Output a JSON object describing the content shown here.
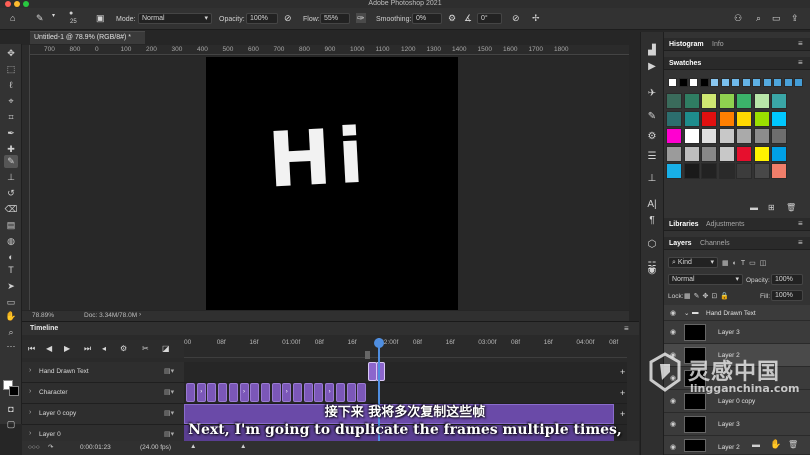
{
  "app": {
    "title": "Adobe Photoshop 2021"
  },
  "options_bar": {
    "brush_size": "25",
    "mode_label": "Mode:",
    "mode_value": "Normal",
    "opacity_label": "Opacity:",
    "opacity_value": "100%",
    "flow_label": "Flow:",
    "flow_value": "55%",
    "smoothing_label": "Smoothing:",
    "smoothing_value": "0%",
    "angle_value": "0°"
  },
  "document": {
    "tab_title": "Untitled-1 @ 78.9% (RGB/8#) *",
    "canvas_text": "Hi",
    "zoom": "78.89%",
    "doc_size": "Doc: 3.34M/78.0M"
  },
  "ruler": [
    "700",
    "800",
    "0",
    "100",
    "200",
    "300",
    "400",
    "500",
    "600",
    "700",
    "800",
    "900",
    "1000",
    "1100",
    "1200",
    "1300",
    "1400",
    "1500",
    "1600",
    "1700",
    "1800"
  ],
  "timeline": {
    "title": "Timeline",
    "timecodes": [
      "00",
      "08f",
      "16f",
      "01:00f",
      "08f",
      "16f",
      "02:00f",
      "08f",
      "16f",
      "03:00f",
      "08f",
      "16f",
      "04:00f",
      "08f",
      "16f",
      "0"
    ],
    "tracks": [
      "Hand Drawn Text",
      "Character",
      "Layer 0 copy",
      "Layer 0"
    ],
    "current_time": "0:00:01:23",
    "fps": "(24.00 fps)"
  },
  "right_panel": {
    "tabs_top": [
      "Histogram",
      "Info"
    ],
    "swatches_tab": "Swatches",
    "swatch_colors": [
      "#3a6b5b",
      "#2f7d62",
      "#cfe872",
      "#8fd14f",
      "#3bb36a",
      "#b8e6a8",
      "#3aa6a6",
      "#2c6e6e",
      "#1e8c8c",
      "#e01010",
      "#ff7f00",
      "#ffd800",
      "#9be000",
      "#00c8ff",
      "#ff00d0",
      "#ffffff",
      "#e0e0e0",
      "#c8c8c8",
      "#aaaaaa",
      "#8c8c8c",
      "#6e6e6e",
      "#9b9b9b",
      "#bdbdbd",
      "#888888",
      "#c8c8c8",
      "#e60f2d",
      "#fff200",
      "#00a0e6",
      "#18b0e8",
      "#1a1a1a",
      "#222222",
      "#2a2a2a",
      "#3c3c3c",
      "#484848",
      "#f07e6a"
    ],
    "swatch_row0": [
      "#ffffff",
      "#000000",
      "#ffffff",
      "#000000",
      "#8ac7f0",
      "#79c0ee",
      "#6fb9ea",
      "#65b3e6",
      "#5eb0e4",
      "#55aadf",
      "#4ea5dc",
      "#4aa1d9",
      "#449dd6"
    ],
    "libraries_tabs": [
      "Libraries",
      "Adjustments"
    ],
    "layers_tabs": [
      "Layers",
      "Channels"
    ],
    "kind_label": "Kind",
    "blend_mode": "Normal",
    "opacity_label": "Opacity:",
    "opacity_value": "100%",
    "lock_label": "Lock:",
    "fill_label": "Fill:",
    "fill_value": "100%",
    "group_name": "Hand Drawn Text",
    "layers": [
      "Layer 3",
      "Layer 2",
      "Layer 0 copy",
      "Layer 3",
      "Layer 2"
    ]
  },
  "subtitles": {
    "cn": "接下来 我将多次复制这些帧",
    "en": "Next, I'm going to duplicate the frames multiple times,"
  },
  "watermark": {
    "cn": "灵感中国",
    "en": "lingganchina.com"
  }
}
